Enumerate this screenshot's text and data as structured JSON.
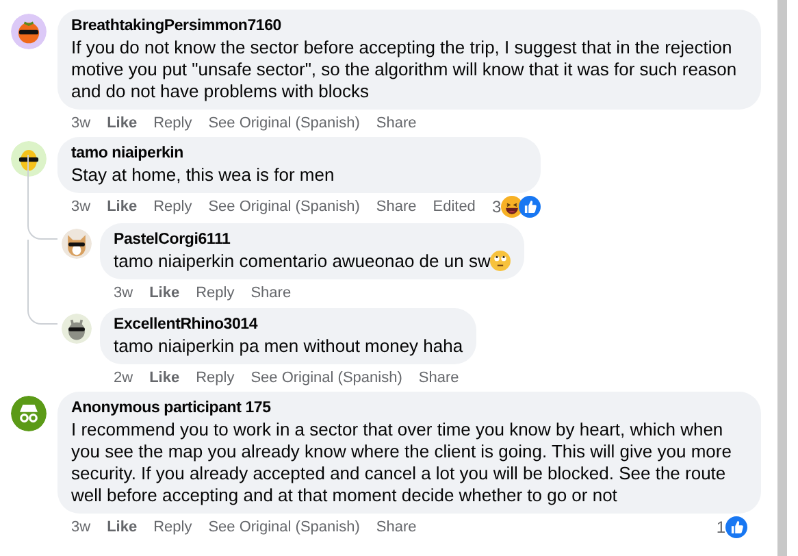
{
  "comments": [
    {
      "author": "BreathtakingPersimmon7160",
      "avatar": {
        "kind": "persimmon"
      },
      "text": "If you do not know the sector before accepting the trip, I suggest that in the rejection motive you put \"unsafe sector\", so the algorithm will know that it was for such reason and do not have problems with blocks",
      "actions": {
        "time": "3w",
        "like": "Like",
        "reply": "Reply",
        "see_original": "See Original (Spanish)",
        "share": "Share"
      }
    },
    {
      "author": "tamo niaiperkin",
      "avatar": {
        "kind": "lemon"
      },
      "text": "Stay at home, this wea is for men",
      "actions": {
        "time": "3w",
        "like": "Like",
        "reply": "Reply",
        "see_original": "See Original (Spanish)",
        "share": "Share",
        "edited": "Edited"
      },
      "reactions": {
        "count": "3",
        "types": [
          {
            "kind": "haha"
          },
          {
            "kind": "like"
          }
        ]
      },
      "replies": [
        {
          "author": "PastelCorgi6111",
          "avatar": {
            "kind": "corgi"
          },
          "text": "tamo niaiperkin comentario awueonao de un sw",
          "emoji": {
            "kind": "eyeroll"
          },
          "actions": {
            "time": "3w",
            "like": "Like",
            "reply": "Reply",
            "share": "Share"
          }
        },
        {
          "author": "ExcellentRhino3014",
          "avatar": {
            "kind": "rhino"
          },
          "text": "tamo niaiperkin pa men without money haha",
          "actions": {
            "time": "2w",
            "like": "Like",
            "reply": "Reply",
            "see_original": "See Original (Spanish)",
            "share": "Share"
          }
        }
      ]
    },
    {
      "author": "Anonymous participant 175",
      "avatar": {
        "kind": "anonymous"
      },
      "text": "I recommend you to work in a sector that over time you know by heart, which when you see the map you already know where the client is going. This will give you more security. If you already accepted and cancel a lot you will be blocked. See the route well before accepting and at that moment decide whether to go or not",
      "actions": {
        "time": "3w",
        "like": "Like",
        "reply": "Reply",
        "see_original": "See Original (Spanish)",
        "share": "Share"
      },
      "reactions": {
        "count": "1",
        "types": [
          {
            "kind": "like"
          }
        ]
      }
    }
  ]
}
